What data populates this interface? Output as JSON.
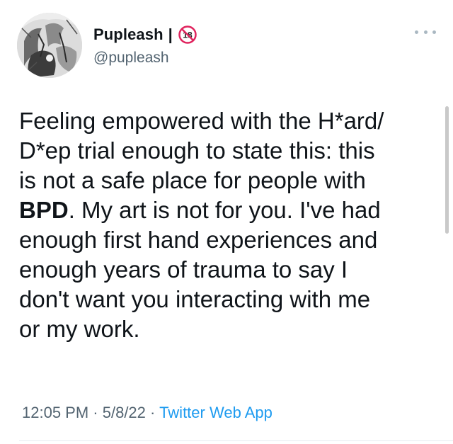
{
  "author": {
    "display_name": "Pupleash",
    "separator": "|",
    "handle": "@pupleash",
    "age_badge": "18"
  },
  "tweet": {
    "lines": [
      "Feeling empowered with the H*ard/",
      "D*ep trial enough to state this: this",
      "is not a safe place for people with"
    ],
    "line4_bold": "BPD",
    "line4_rest": ". My art is not for you. I've had",
    "lines_after": [
      "enough first hand experiences and",
      "enough years of trauma to say I",
      "don't want you interacting with me",
      "or my work."
    ]
  },
  "meta": {
    "time": "12:05 PM",
    "dot1": " · ",
    "date": "5/8/22",
    "dot2": " · ",
    "source": "Twitter Web App"
  },
  "icons": {
    "more": "more-options-icon",
    "badge": "no-under-18-icon"
  },
  "colors": {
    "text": "#0f1419",
    "secondary": "#536471",
    "link": "#1d9bf0",
    "badge_red": "#e0245e"
  }
}
